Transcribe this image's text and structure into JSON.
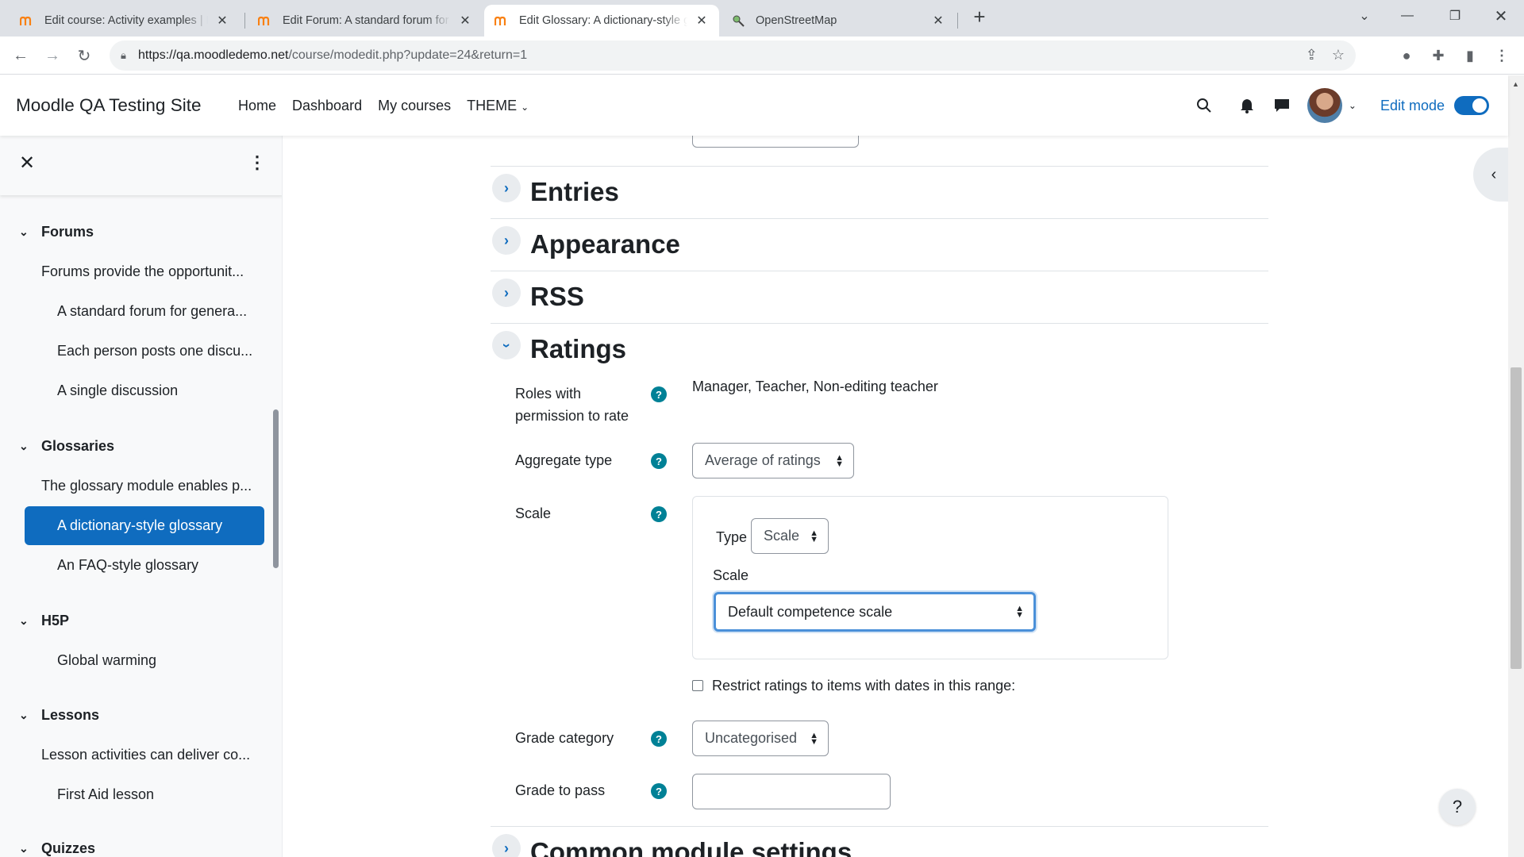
{
  "browser": {
    "tabs": [
      {
        "title": "Edit course: Activity examples | Moodle",
        "active": false
      },
      {
        "title": "Edit Forum: A standard forum for general use",
        "active": false
      },
      {
        "title": "Edit Glossary: A dictionary-style glossary",
        "active": true
      },
      {
        "title": "OpenStreetMap",
        "active": false
      }
    ],
    "url_host": "https://qa.moodledemo.net",
    "url_path": "/course/modedit.php?update=24&return=1"
  },
  "navbar": {
    "site_name": "Moodle QA Testing Site",
    "links": [
      "Home",
      "Dashboard",
      "My courses",
      "THEME"
    ],
    "edit_mode_label": "Edit mode"
  },
  "course_index": {
    "sections": [
      {
        "title": "Forums",
        "items": [
          "Forums provide the opportunit...",
          "A standard forum for genera...",
          "Each person posts one discu...",
          "A single discussion"
        ]
      },
      {
        "title": "Glossaries",
        "items": [
          "The glossary module enables p...",
          "A dictionary-style glossary",
          "An FAQ-style glossary"
        ]
      },
      {
        "title": "H5P",
        "items": [
          "Global warming"
        ]
      },
      {
        "title": "Lessons",
        "items": [
          "Lesson activities can deliver co...",
          "First Aid lesson"
        ]
      },
      {
        "title": "Quizzes",
        "items": []
      }
    ]
  },
  "form": {
    "sections": {
      "entries": "Entries",
      "appearance": "Appearance",
      "rss": "RSS",
      "ratings": "Ratings",
      "common": "Common module settings"
    },
    "roles_label": "Roles with permission to rate",
    "roles_value": "Manager, Teacher, Non-editing teacher",
    "aggregate_label": "Aggregate type",
    "aggregate_value": "Average of ratings",
    "scale_label": "Scale",
    "type_label": "Type",
    "type_value": "Scale",
    "scale_sub_label": "Scale",
    "scale_value": "Default competence scale",
    "restrict_label": "Restrict ratings to items with dates in this range:",
    "grade_category_label": "Grade category",
    "grade_category_value": "Uncategorised",
    "grade_to_pass_label": "Grade to pass",
    "grade_to_pass_value": ""
  },
  "colors": {
    "accent": "#0f6cbf",
    "help": "#008196"
  }
}
